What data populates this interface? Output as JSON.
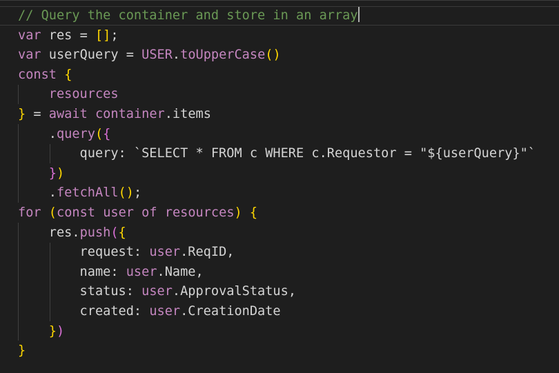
{
  "editor": {
    "language": "javascript",
    "colors": {
      "background": "#1e1e1e",
      "comment": "#6a9955",
      "keyword": "#c586c0",
      "text": "#d4d4d4",
      "bracket_gold": "#ffd700",
      "bracket_purple": "#da70d6"
    },
    "lines": [
      "// Query the container and store in an array",
      "var res = [];",
      "var userQuery = USER.toUpperCase()",
      "const {",
      "    resources",
      "} = await container.items",
      "    .query({",
      "        query: `SELECT * FROM c WHERE c.Requestor = \"${userQuery}\"`",
      "    })",
      "    .fetchAll();",
      "for (const user of resources) {",
      "    res.push({",
      "        request: user.ReqID,",
      "        name: user.Name,",
      "        status: user.ApprovalStatus,",
      "        created: user.CreationDate",
      "    })",
      "}"
    ]
  }
}
